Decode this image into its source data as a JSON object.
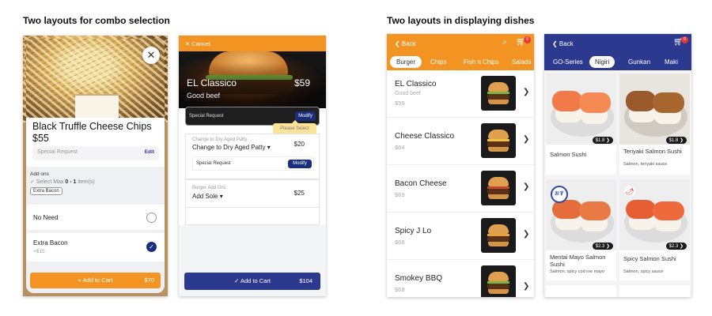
{
  "headings": {
    "left": "Two layouts for combo selection",
    "right": "Two layouts in displaying dishes"
  },
  "colors": {
    "orange": "#f39321",
    "navy": "#2b3a8f",
    "badge": "#e33333"
  },
  "phone1": {
    "close_icon": "close-icon",
    "title": "Black Truffle Cheese Chips",
    "price": "$55",
    "special_request_placeholder": "Special Request",
    "edit_label": "Edit",
    "addons_label": "Add ons",
    "addons_select_prefix": "✓ Select Max ",
    "addons_select_range": "0 - 1",
    "addons_select_suffix": " item(s)",
    "selected_chip": "Extra Bacon",
    "options": [
      {
        "label": "No Need",
        "sub": "",
        "checked": false
      },
      {
        "label": "Extra Bacon",
        "sub": "+$15",
        "checked": true
      }
    ],
    "cart_label": "+ Add to Cart",
    "cart_price": "$70"
  },
  "phone2": {
    "cancel_label": "✕ Cancel",
    "title": "EL Classico",
    "price": "$59",
    "subtitle": "Good beef",
    "special_request": "Special Request",
    "modify_label": "Modify",
    "tooltip": "Please Select",
    "group1_small": "Change to Dry Aged Patty",
    "group1_main": "Change to Dry Aged Patty ▾",
    "group1_price": "$20",
    "group1_request": "Special Request",
    "group1_modify": "Modify",
    "group2_small": "Burger Add Ons",
    "group2_main": "Add Sole ▾",
    "group2_price": "$25",
    "cart_label": "✓ Add to Cart",
    "cart_price": "$104"
  },
  "phone3": {
    "back_label": "❮ Back",
    "badge": "0",
    "tabs": [
      "Burger",
      "Chips",
      "Fish n Chips",
      "Salads"
    ],
    "active_tab": 0,
    "items": [
      {
        "name": "EL Classico",
        "desc": "Good beef",
        "price": "$59"
      },
      {
        "name": "Cheese Classico",
        "desc": "",
        "price": "$64"
      },
      {
        "name": "Bacon Cheese",
        "desc": "",
        "price": "$69"
      },
      {
        "name": "Spicy J Lo",
        "desc": "",
        "price": "$68"
      },
      {
        "name": "Smokey BBQ",
        "desc": "",
        "price": "$68"
      }
    ]
  },
  "phone4": {
    "back_label": "❮ Back",
    "badge": "0",
    "tabs": [
      "GO-Series",
      "Nigiri",
      "Gunkan",
      "Maki"
    ],
    "active_tab": 1,
    "tiles": [
      {
        "name": "Salmon Sushi",
        "desc": "",
        "price_tag": "$1.8 ❯"
      },
      {
        "name": "Teriyaki Salmon Sushi",
        "desc": "Salmon, teriyaki sauce",
        "price_tag": "$1.8 ❯"
      },
      {
        "name": "Mentai Mayo Salmon Sushi",
        "desc": "Salmon, spicy cod roe mayo",
        "price_tag": "$2.3 ❯"
      },
      {
        "name": "Spicy Salmon Sushi",
        "desc": "Salmon, spicy sauce",
        "price_tag": "$2.3 ❯"
      }
    ]
  }
}
